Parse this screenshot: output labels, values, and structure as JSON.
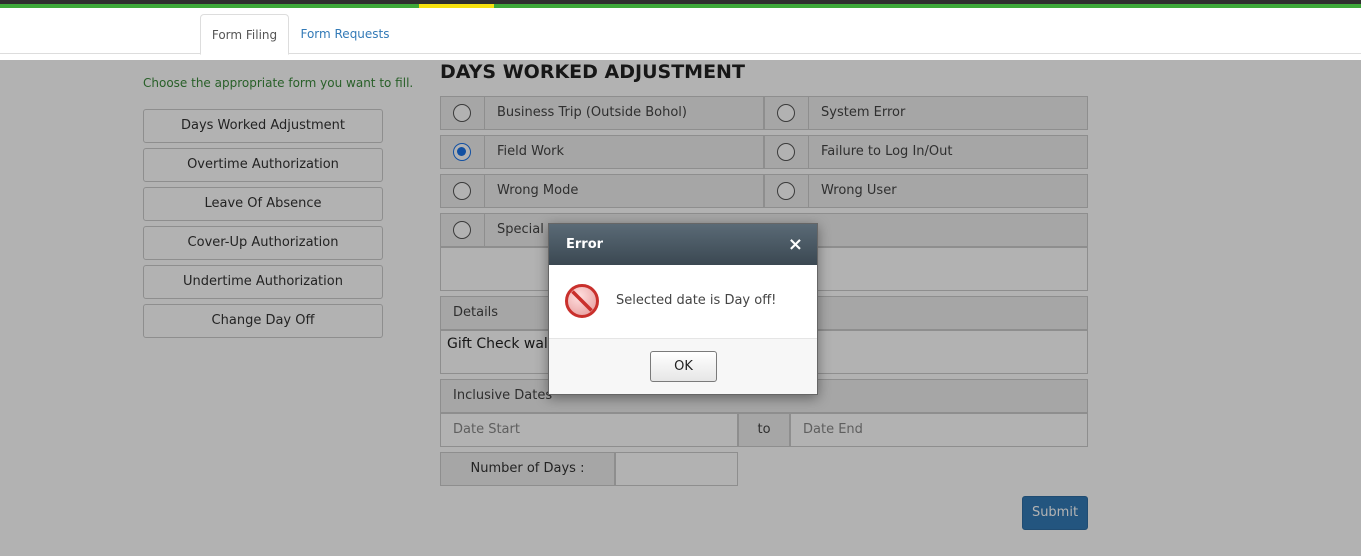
{
  "tabs": [
    {
      "label": "Form Filing"
    },
    {
      "label": "Form Requests"
    }
  ],
  "sidebar": {
    "instructions": "Choose the appropriate form you want to fill.",
    "items": [
      {
        "label": "Days Worked Adjustment"
      },
      {
        "label": "Overtime Authorization"
      },
      {
        "label": "Leave Of Absence"
      },
      {
        "label": "Cover-Up Authorization"
      },
      {
        "label": "Undertime Authorization"
      },
      {
        "label": "Change Day Off"
      }
    ]
  },
  "form": {
    "title": "DAYS WORKED ADJUSTMENT",
    "options": [
      {
        "label": "Business Trip (Outside Bohol)",
        "checked": false
      },
      {
        "label": "System Error",
        "checked": false
      },
      {
        "label": "Field Work",
        "checked": true
      },
      {
        "label": "Failure to Log In/Out",
        "checked": false
      },
      {
        "label": "Wrong Mode",
        "checked": false
      },
      {
        "label": "Wrong User",
        "checked": false
      },
      {
        "label": "Special A",
        "checked": false
      }
    ],
    "details_label": "Details",
    "details_value": "Gift Check walkt",
    "inclusive_dates_label": "Inclusive Dates",
    "date_start_placeholder": "Date Start",
    "to_label": "to",
    "date_end_placeholder": "Date End",
    "number_of_days_label": "Number of Days :",
    "number_of_days_value": "",
    "submit_label": "Submit"
  },
  "dialog": {
    "title": "Error",
    "close_symbol": "×",
    "message": "Selected date is Day off!",
    "ok_label": "OK",
    "icon": "stop-icon"
  },
  "colors": {
    "topbar_green": "#3ea83a",
    "topbar_yellow": "#f5e10f",
    "link_blue": "#337ab7",
    "instruction_green": "#3c8a3c",
    "submit_blue": "#337ab7",
    "radio_blue": "#1a73e8"
  }
}
